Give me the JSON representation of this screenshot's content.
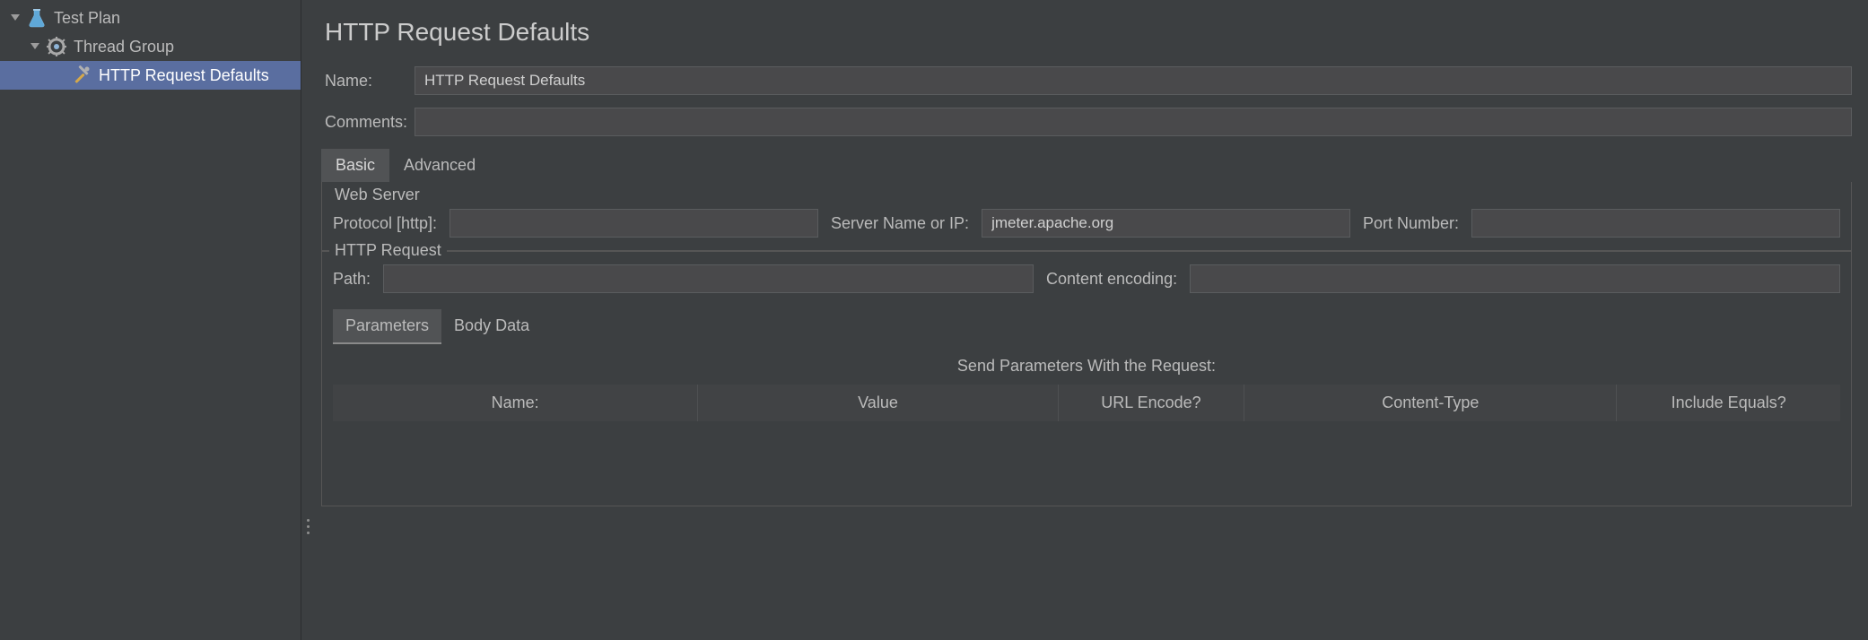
{
  "tree": {
    "test_plan": "Test Plan",
    "thread_group": "Thread Group",
    "http_request_defaults": "HTTP Request Defaults"
  },
  "page": {
    "title": "HTTP Request Defaults"
  },
  "form": {
    "name_label": "Name:",
    "name_value": "HTTP Request Defaults",
    "comments_label": "Comments:",
    "comments_value": ""
  },
  "tabs": {
    "basic": "Basic",
    "advanced": "Advanced"
  },
  "web_server": {
    "legend": "Web Server",
    "protocol_label": "Protocol [http]:",
    "protocol_value": "",
    "server_label": "Server Name or IP:",
    "server_value": "jmeter.apache.org",
    "port_label": "Port Number:",
    "port_value": ""
  },
  "http_request": {
    "legend": "HTTP Request",
    "path_label": "Path:",
    "path_value": "",
    "encoding_label": "Content encoding:",
    "encoding_value": ""
  },
  "sub_tabs": {
    "parameters": "Parameters",
    "body_data": "Body Data"
  },
  "params": {
    "section_title": "Send Parameters With the Request:",
    "columns": {
      "name": "Name:",
      "value": "Value",
      "url_encode": "URL Encode?",
      "content_type": "Content-Type",
      "include_equals": "Include Equals?"
    }
  }
}
